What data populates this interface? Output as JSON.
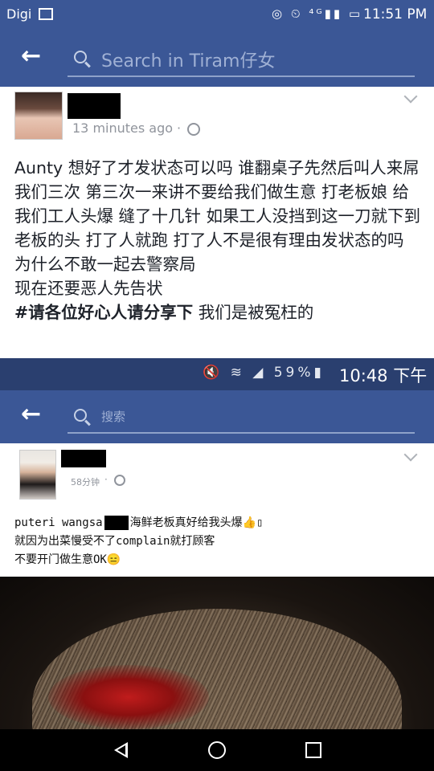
{
  "status_bar_top": {
    "carrier": "Digi",
    "icons": "◎ ⏲ ⁴ᴳ▮▮ ▭",
    "time": "11:51 PM"
  },
  "header_top": {
    "search_placeholder": "Search in Tiram仔女"
  },
  "post_top": {
    "time": "13 minutes ago",
    "separator": "·",
    "paragraphs": [
      "Aunty 想好了才发状态可以吗 谁翻桌子先然后叫人来屌我们三次 第三次一来讲不要给我们做生意 打老板娘 给我们工人头爆  缝了十几针 如果工人没挡到这一刀就下到老板的头 打了人就跑 打了人不是很有理由发状态的吗 为什么不敢一起去警察局",
      " 现在还要恶人先告状"
    ],
    "hashtag": "#请各位好心人请分享下",
    "hashtag_suffix": " 我们是被冤枉的"
  },
  "status_bar_bottom": {
    "icons": "🔇 ≋ ◢ 59%▮",
    "time": "10:48 下午"
  },
  "header_bottom": {
    "search_placeholder": "搜索"
  },
  "post_bottom": {
    "time": "58分钟",
    "separator": "·",
    "line1_prefix": "puteri wangsa",
    "line1_suffix": "海鲜老板真好给我头爆👍▯",
    "line2": "就因为出菜慢受不了complain就打顾客",
    "line3": "不要开门做生意OK😑"
  },
  "colors": {
    "facebook_blue": "#3b5796",
    "status_dark": "#2a3f6f"
  }
}
